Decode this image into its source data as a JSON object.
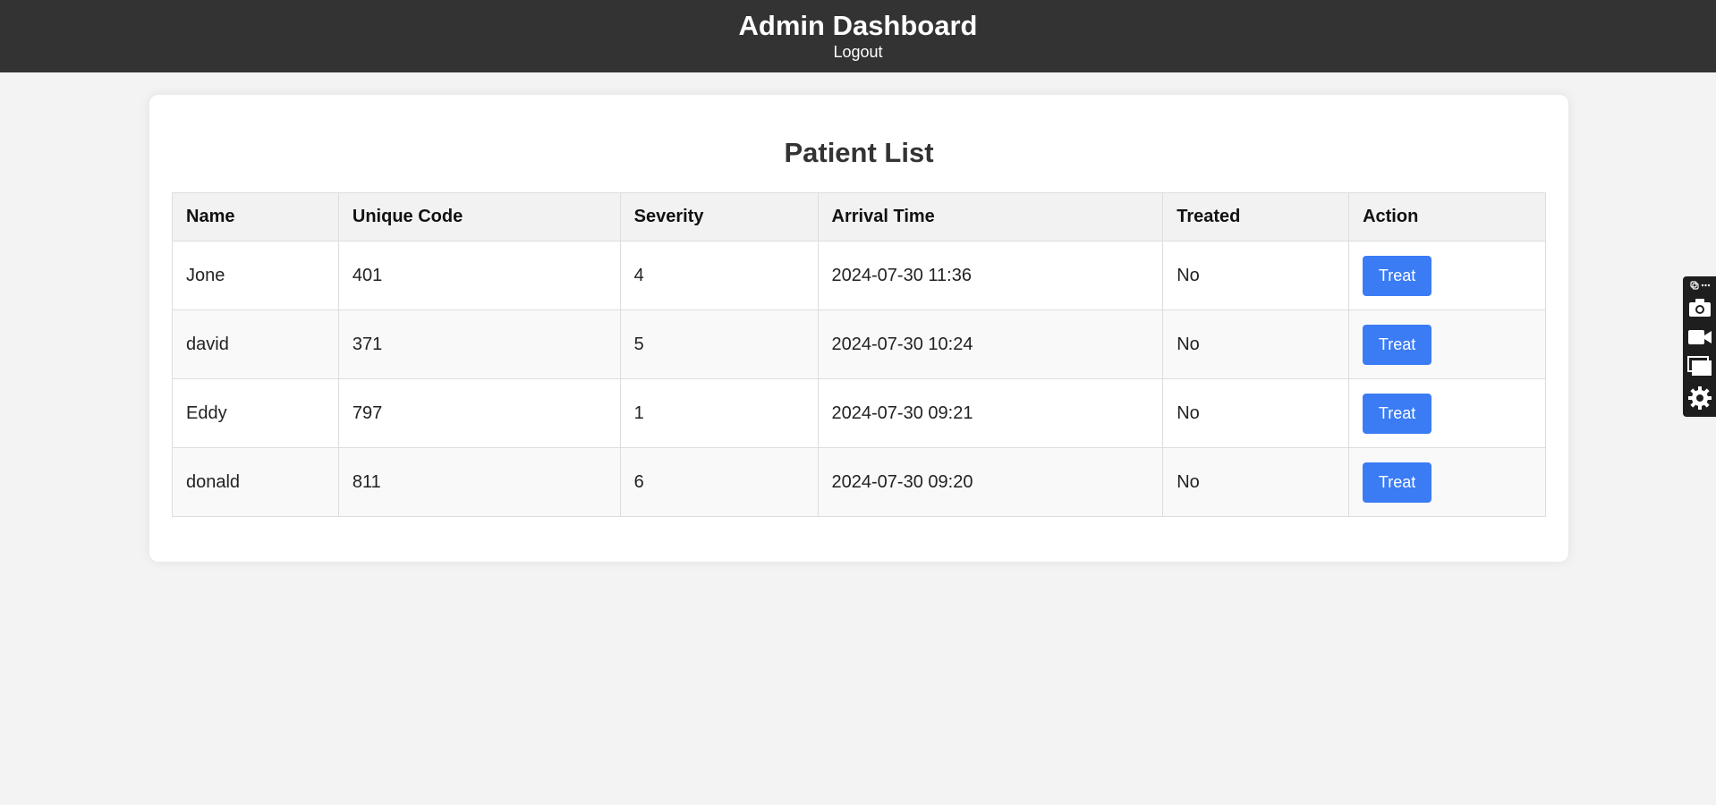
{
  "header": {
    "title": "Admin Dashboard",
    "logout_label": "Logout"
  },
  "main": {
    "heading": "Patient List",
    "table": {
      "columns": [
        "Name",
        "Unique Code",
        "Severity",
        "Arrival Time",
        "Treated",
        "Action"
      ],
      "rows": [
        {
          "name": "Jone",
          "code": "401",
          "severity": "4",
          "arrival": "2024-07-30 11:36",
          "treated": "No",
          "action": "Treat"
        },
        {
          "name": "david",
          "code": "371",
          "severity": "5",
          "arrival": "2024-07-30 10:24",
          "treated": "No",
          "action": "Treat"
        },
        {
          "name": "Eddy",
          "code": "797",
          "severity": "1",
          "arrival": "2024-07-30 09:21",
          "treated": "No",
          "action": "Treat"
        },
        {
          "name": "donald",
          "code": "811",
          "severity": "6",
          "arrival": "2024-07-30 09:20",
          "treated": "No",
          "action": "Treat"
        }
      ]
    }
  },
  "side_toolbar": {
    "icons": [
      "link-more-icon",
      "camera-icon",
      "video-camera-icon",
      "windows-icon",
      "gear-icon"
    ]
  },
  "colors": {
    "header_bg": "#333333",
    "page_bg": "#f3f3f3",
    "button_bg": "#3b7cf5",
    "toolbar_bg": "#1e1e1e"
  }
}
